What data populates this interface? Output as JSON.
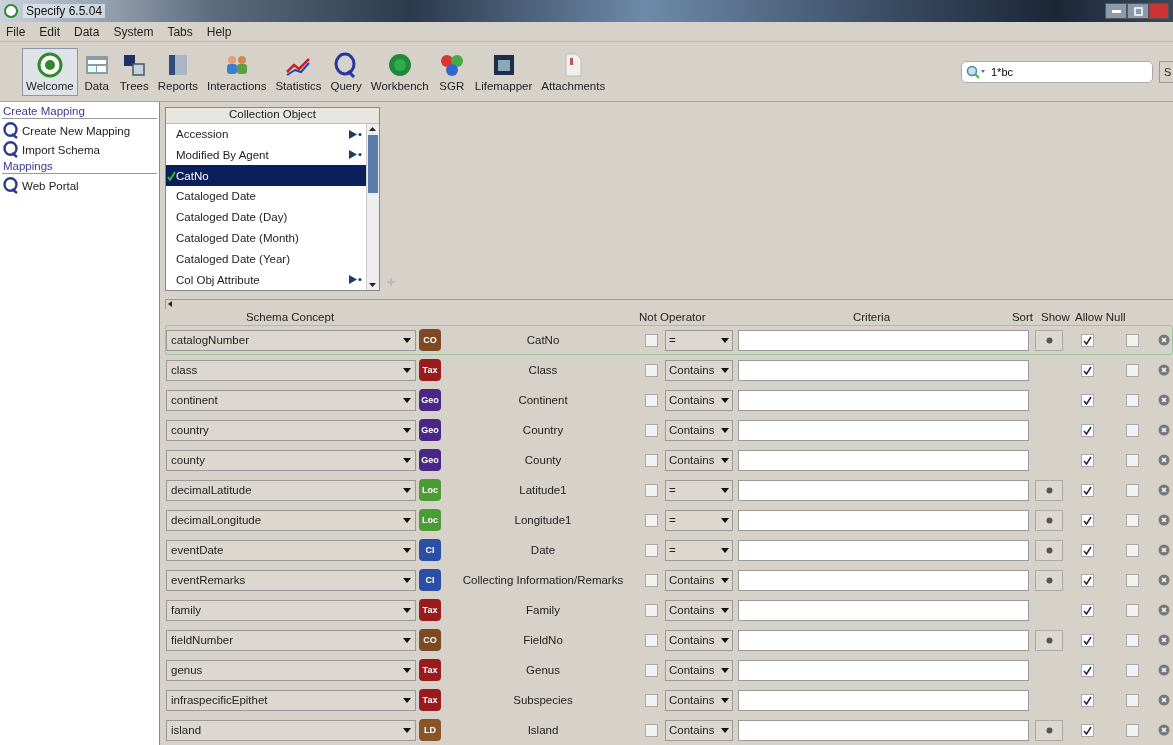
{
  "window": {
    "title": "Specify 6.5.04"
  },
  "menu": [
    {
      "label": "File"
    },
    {
      "label": "Edit"
    },
    {
      "label": "Data"
    },
    {
      "label": "System"
    },
    {
      "label": "Tabs"
    },
    {
      "label": "Help"
    }
  ],
  "toolbar": [
    {
      "label": "Welcome",
      "selected": true
    },
    {
      "label": "Data",
      "selected": false
    },
    {
      "label": "Trees",
      "selected": false
    },
    {
      "label": "Reports",
      "selected": false
    },
    {
      "label": "Interactions",
      "selected": false
    },
    {
      "label": "Statistics",
      "selected": false
    },
    {
      "label": "Query",
      "selected": false
    },
    {
      "label": "Workbench",
      "selected": false
    },
    {
      "label": "SGR",
      "selected": false
    },
    {
      "label": "Lifemapper",
      "selected": false
    },
    {
      "label": "Attachments",
      "selected": false
    }
  ],
  "search": {
    "value": "1*bc",
    "button": "S"
  },
  "sidebar": [
    {
      "heading": "Create Mapping",
      "items": [
        "Create New Mapping",
        "Import Schema"
      ]
    },
    {
      "heading": "Mappings",
      "items": [
        "Web Portal"
      ]
    }
  ],
  "field_picker": {
    "title": "Collection Object",
    "items": [
      {
        "label": "Accession",
        "selected": false,
        "has_children": true
      },
      {
        "label": "Modified By Agent",
        "selected": false,
        "has_children": true
      },
      {
        "label": "CatNo",
        "selected": true,
        "has_children": false
      },
      {
        "label": "Cataloged Date",
        "selected": false,
        "has_children": false
      },
      {
        "label": "Cataloged Date (Day)",
        "selected": false,
        "has_children": false
      },
      {
        "label": "Cataloged Date (Month)",
        "selected": false,
        "has_children": false
      },
      {
        "label": "Cataloged Date (Year)",
        "selected": false,
        "has_children": false
      },
      {
        "label": "Col Obj Attribute",
        "selected": false,
        "has_children": true
      }
    ]
  },
  "table": {
    "columns": [
      "Schema Concept",
      "Not Operator",
      "Criteria",
      "Sort",
      "Show",
      "Allow Null"
    ],
    "rows": [
      {
        "concept": "catalogNumber",
        "badge": "CO",
        "color": "#7b4a22",
        "field": "CatNo",
        "not": false,
        "operator": "=",
        "sortable": true,
        "show": true,
        "allow_null": false,
        "selected": true
      },
      {
        "concept": "class",
        "badge": "Tax",
        "color": "#9a1b1e",
        "field": "Class",
        "not": false,
        "operator": "Contains",
        "sortable": false,
        "show": true,
        "allow_null": false,
        "selected": false
      },
      {
        "concept": "continent",
        "badge": "Geo",
        "color": "#4a2687",
        "field": "Continent",
        "not": false,
        "operator": "Contains",
        "sortable": false,
        "show": true,
        "allow_null": false,
        "selected": false
      },
      {
        "concept": "country",
        "badge": "Geo",
        "color": "#4a2687",
        "field": "Country",
        "not": false,
        "operator": "Contains",
        "sortable": false,
        "show": true,
        "allow_null": false,
        "selected": false
      },
      {
        "concept": "county",
        "badge": "Geo",
        "color": "#4a2687",
        "field": "County",
        "not": false,
        "operator": "Contains",
        "sortable": false,
        "show": true,
        "allow_null": false,
        "selected": false
      },
      {
        "concept": "decimalLatitude",
        "badge": "Loc",
        "color": "#4c9c35",
        "field": "Latitude1",
        "not": false,
        "operator": "=",
        "sortable": true,
        "show": true,
        "allow_null": false,
        "selected": false
      },
      {
        "concept": "decimalLongitude",
        "badge": "Loc",
        "color": "#4c9c35",
        "field": "Longitude1",
        "not": false,
        "operator": "=",
        "sortable": true,
        "show": true,
        "allow_null": false,
        "selected": false
      },
      {
        "concept": "eventDate",
        "badge": "CI",
        "color": "#2c4fa6",
        "field": "Date",
        "not": false,
        "operator": "=",
        "sortable": true,
        "show": true,
        "allow_null": false,
        "selected": false
      },
      {
        "concept": "eventRemarks",
        "badge": "CI",
        "color": "#2c4fa6",
        "field": "Collecting Information/Remarks",
        "not": false,
        "operator": "Contains",
        "sortable": true,
        "show": true,
        "allow_null": false,
        "selected": false
      },
      {
        "concept": "family",
        "badge": "Tax",
        "color": "#9a1b1e",
        "field": "Family",
        "not": false,
        "operator": "Contains",
        "sortable": false,
        "show": true,
        "allow_null": false,
        "selected": false
      },
      {
        "concept": "fieldNumber",
        "badge": "CO",
        "color": "#7b4a22",
        "field": "FieldNo",
        "not": false,
        "operator": "Contains",
        "sortable": true,
        "show": true,
        "allow_null": false,
        "selected": false
      },
      {
        "concept": "genus",
        "badge": "Tax",
        "color": "#9a1b1e",
        "field": "Genus",
        "not": false,
        "operator": "Contains",
        "sortable": false,
        "show": true,
        "allow_null": false,
        "selected": false
      },
      {
        "concept": "infraspecificEpithet",
        "badge": "Tax",
        "color": "#9a1b1e",
        "field": "Subspecies",
        "not": false,
        "operator": "Contains",
        "sortable": false,
        "show": true,
        "allow_null": false,
        "selected": false
      },
      {
        "concept": "island",
        "badge": "LD",
        "color": "#8a5526",
        "field": "Island",
        "not": false,
        "operator": "Contains",
        "sortable": true,
        "show": true,
        "allow_null": false,
        "selected": false
      }
    ]
  }
}
